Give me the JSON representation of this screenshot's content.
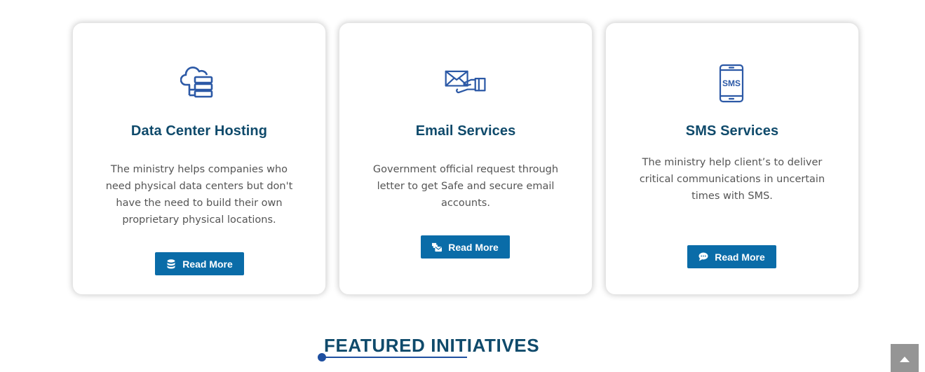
{
  "colors": {
    "title": "#0f4a6b",
    "icon": "#2c59a6",
    "button": "#0a6ca8",
    "text": "#555555",
    "underline": "#1e4fa0",
    "scroll_button": "#8a8a8a"
  },
  "cards": [
    {
      "icon": "cloud-server-stack-icon",
      "title": "Data Center Hosting",
      "text": "The ministry helps companies who need physical data centers but don't have the need to build their own proprietary physical locations.",
      "button_icon": "database-icon",
      "button_label": "Read More"
    },
    {
      "icon": "envelope-hand-icon",
      "title": "Email Services",
      "text": "Government official request through letter to get Safe and secure email accounts.",
      "button_icon": "mail-bulk-icon",
      "button_label": "Read More"
    },
    {
      "icon": "smartphone-sms-icon",
      "title": "SMS Services",
      "text": "The ministry help client’s to deliver critical communications in uncertain times with SMS.",
      "button_icon": "comment-icon",
      "button_label": "Read More",
      "sms_badge": "SMS"
    }
  ],
  "featured": {
    "heading": "FEATURED INITIATIVES"
  },
  "scroll_top": {
    "icon": "caret-up-icon"
  }
}
